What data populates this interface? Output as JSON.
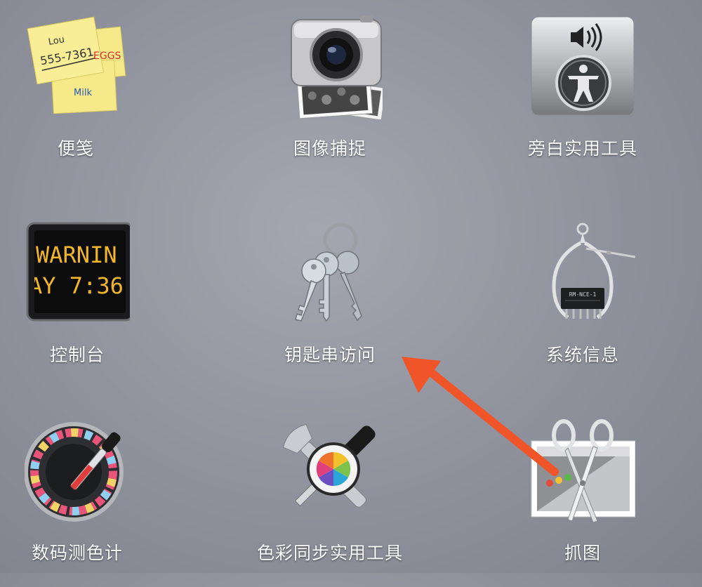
{
  "launchpad": {
    "apps": [
      {
        "label": "便笺",
        "icon": "stickies-icon",
        "note_lou": "Lou",
        "note_phone": "555-7361",
        "note_eggs": "EGGS",
        "note_milk": "Milk"
      },
      {
        "label": "图像捕捉",
        "icon": "camera-icon"
      },
      {
        "label": "旁白实用工具",
        "icon": "accessibility-icon"
      },
      {
        "label": "控制台",
        "icon": "console-icon",
        "screen_line1": "WARNIN",
        "screen_line2": "AY 7:36"
      },
      {
        "label": "钥匙串访问",
        "icon": "keys-icon"
      },
      {
        "label": "系统信息",
        "icon": "caliper-chip-icon",
        "chip_text": "RM-NCE-1"
      },
      {
        "label": "数码测色计",
        "icon": "colorimeter-icon"
      },
      {
        "label": "色彩同步实用工具",
        "icon": "tools-colorwheel-icon"
      },
      {
        "label": "抓图",
        "icon": "scissors-icon"
      }
    ]
  },
  "annotation": {
    "arrow_color": "#f0552a"
  }
}
